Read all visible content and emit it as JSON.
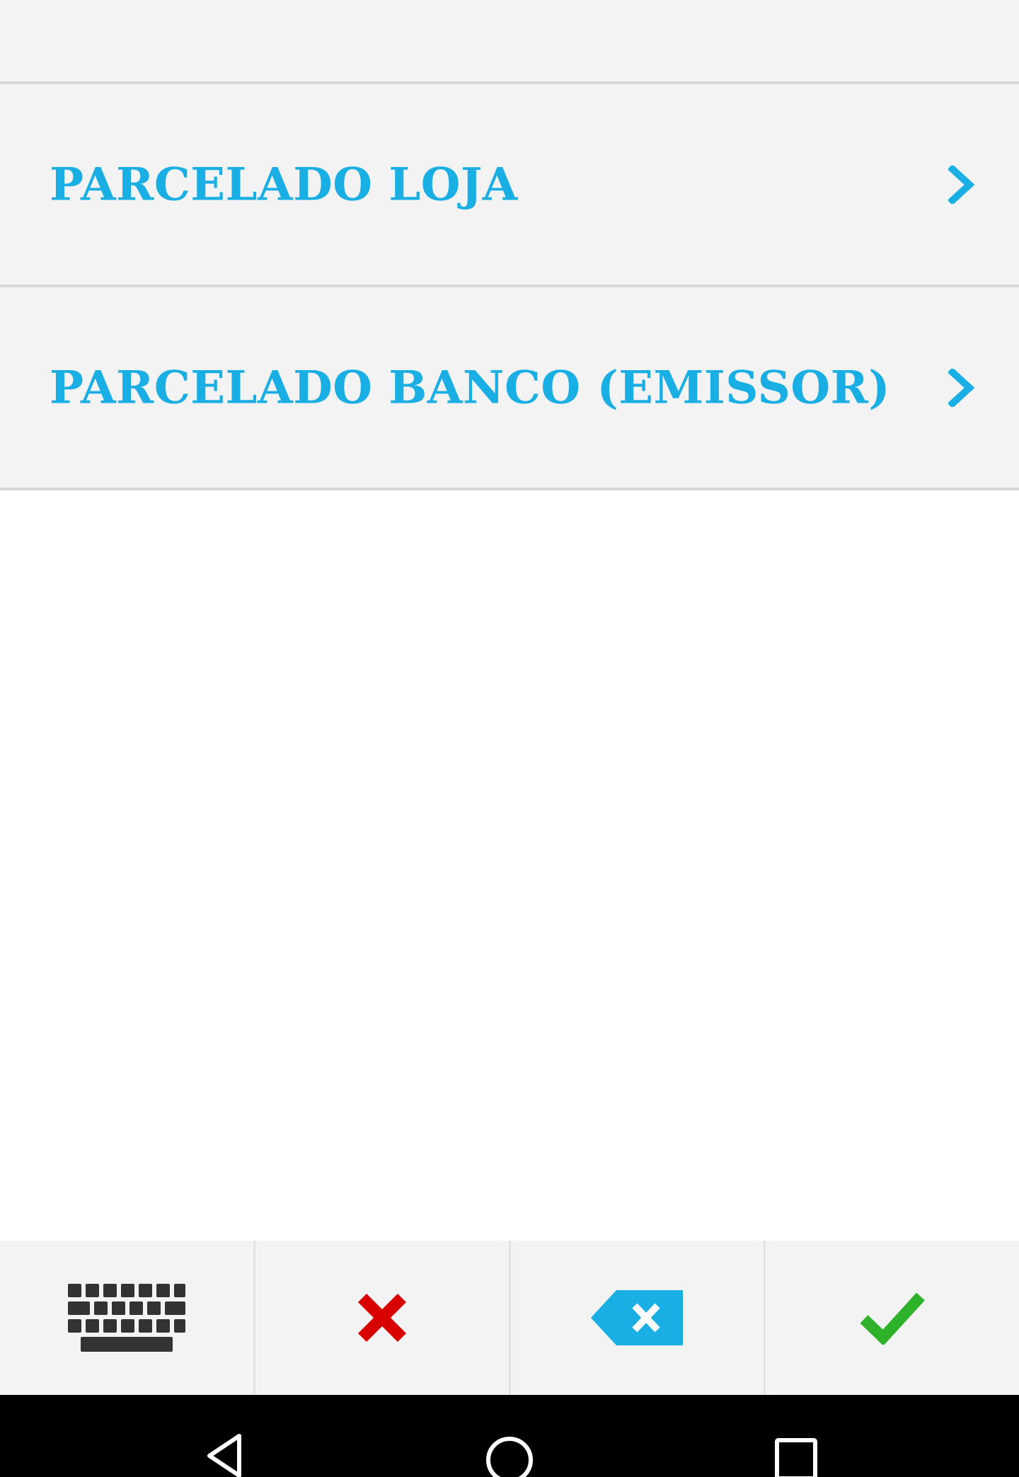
{
  "menu": {
    "items": [
      {
        "label": "PARCELADO LOJA"
      },
      {
        "label": "PARCELADO BANCO (EMISSOR)"
      }
    ]
  },
  "colors": {
    "accent": "#19aee4",
    "cancel": "#d90000",
    "confirm": "#2db22a",
    "keyboard_icon": "#333333",
    "list_background": "#f3f3f3"
  },
  "toolbar": {
    "buttons": [
      {
        "icon": "keyboard-icon"
      },
      {
        "icon": "close-icon"
      },
      {
        "icon": "backspace-icon"
      },
      {
        "icon": "check-icon"
      }
    ]
  },
  "navigation": {
    "buttons": [
      {
        "icon": "back-icon"
      },
      {
        "icon": "home-icon"
      },
      {
        "icon": "recents-icon"
      }
    ]
  }
}
